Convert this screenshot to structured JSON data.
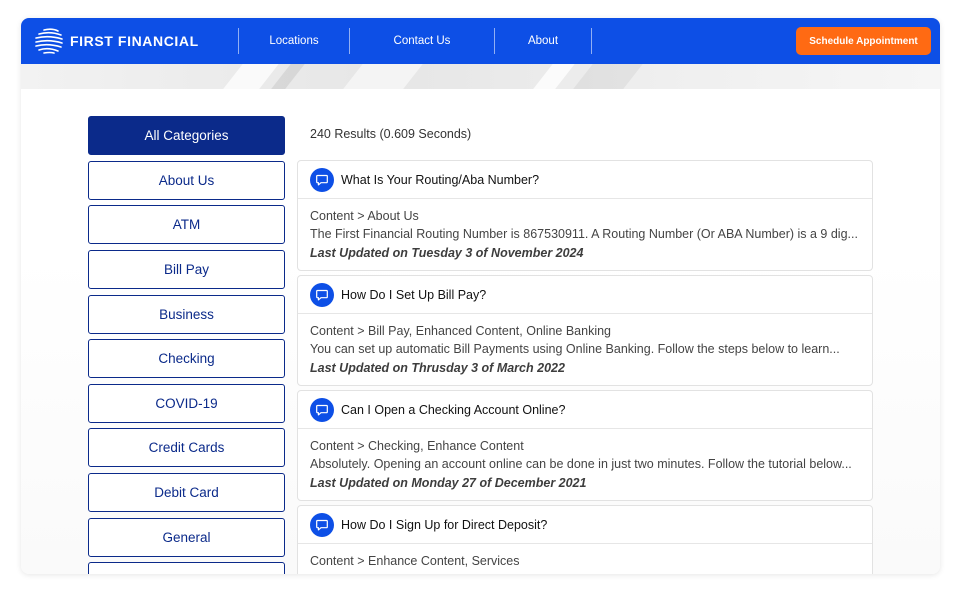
{
  "header": {
    "logo_text": "FIRST FINANCIAL",
    "nav": [
      {
        "label": "Locations"
      },
      {
        "label": "Contact Us"
      },
      {
        "label": "About"
      }
    ],
    "cta_label": "Schedule Appointment"
  },
  "colors": {
    "brand_blue": "#0d4fe6",
    "navy": "#0b2a8a",
    "cta_orange": "#ff6a13"
  },
  "sidebar": {
    "categories": [
      {
        "label": "All Categories",
        "active": true
      },
      {
        "label": "About Us"
      },
      {
        "label": "ATM"
      },
      {
        "label": "Bill Pay"
      },
      {
        "label": "Business"
      },
      {
        "label": "Checking"
      },
      {
        "label": "COVID-19"
      },
      {
        "label": "Credit Cards"
      },
      {
        "label": "Debit Card"
      },
      {
        "label": "General"
      }
    ]
  },
  "results": {
    "count_text": "240 Results (0.609 Seconds)",
    "items": [
      {
        "icon": "chat-bubble-icon",
        "title": "What Is Your Routing/Aba Number?",
        "category": "Content > About Us",
        "snippet": "The First Financial Routing Number is 867530911. A Routing Number (Or ABA Number) is a 9 dig...",
        "updated": "Last Updated on Tuesday 3 of November 2024"
      },
      {
        "icon": "chat-bubble-icon",
        "title": "How Do I Set Up Bill Pay?",
        "category": "Content > Bill Pay, Enhanced Content, Online Banking",
        "snippet": "You can set up automatic Bill Payments using Online Banking. Follow the steps below to learn...",
        "updated": "Last Updated on Thrusday 3 of March 2022"
      },
      {
        "icon": "chat-bubble-icon",
        "title": "Can I Open a Checking Account Online?",
        "category": "Content > Checking, Enhance Content",
        "snippet": "Absolutely. Opening an account online can be done in just two minutes. Follow the tutorial below...",
        "updated": "Last Updated on Monday 27 of December 2021"
      },
      {
        "icon": "chat-bubble-icon",
        "title": "How Do I Sign Up for Direct Deposit?",
        "category": "Content > Enhance Content, Services",
        "snippet": "",
        "updated": ""
      }
    ]
  }
}
